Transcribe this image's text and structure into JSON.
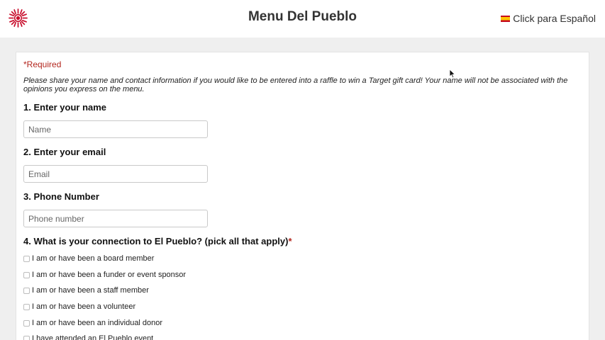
{
  "header": {
    "title": "Menu Del Pueblo",
    "language_link": "Click para Español",
    "logo_icon": "sun-logo-icon",
    "flag_icon": "spain-flag-icon"
  },
  "form": {
    "required_note": "*Required",
    "intro": "Please share your name and contact information if you would like to be entered into a raffle to win a Target gift card! Your name will not be associated with the opinions you express on the menu.",
    "questions": [
      {
        "label": "1. Enter your name",
        "placeholder": "Name",
        "value": ""
      },
      {
        "label": "2. Enter your email",
        "placeholder": "Email",
        "value": ""
      },
      {
        "label": "3. Phone Number",
        "placeholder": "Phone number",
        "value": ""
      }
    ],
    "connection": {
      "label": "4. What is your connection to El Pueblo? (pick all that apply)",
      "required_marker": "*",
      "options": [
        {
          "label": "I am or have been a board member",
          "checked": false
        },
        {
          "label": "I am or have been a funder or event sponsor",
          "checked": false
        },
        {
          "label": "I am or have been a staff member",
          "checked": false
        },
        {
          "label": "I am or have been a volunteer",
          "checked": false
        },
        {
          "label": "I am or have been an individual donor",
          "checked": false
        },
        {
          "label": "I have attended an El Pueblo event",
          "checked": false
        }
      ]
    }
  },
  "colors": {
    "required": "#b3261e",
    "logo": "#c8102e",
    "page_background": "#efefef"
  }
}
